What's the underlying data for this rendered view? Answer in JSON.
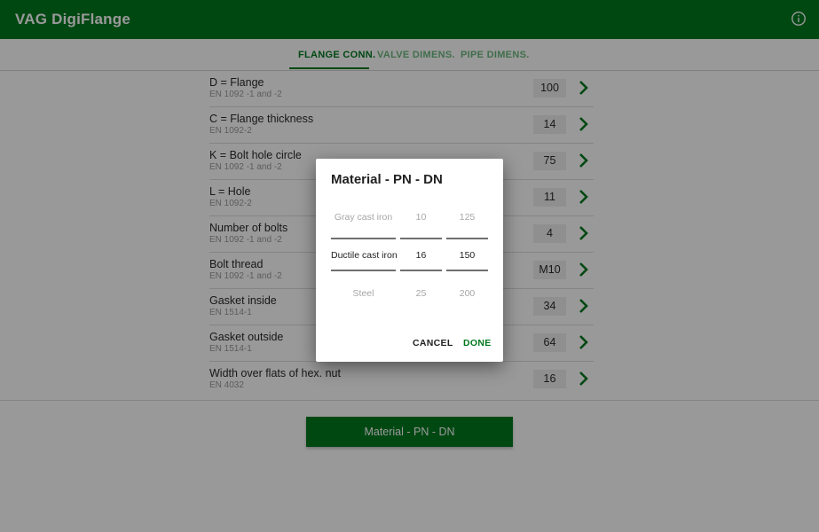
{
  "app": {
    "title": "VAG DigiFlange",
    "info_icon": "info-icon",
    "colors": {
      "brand": "#00781e",
      "tab_inactive": "#6cb77e"
    }
  },
  "tabs": [
    {
      "label": "FLANGE CONN.",
      "active": true
    },
    {
      "label": "VALVE DIMENS.",
      "active": false
    },
    {
      "label": "PIPE DIMENS.",
      "active": false
    }
  ],
  "rows": [
    {
      "title": "D = Flange",
      "sub": "EN 1092 -1 and -2",
      "value": "100"
    },
    {
      "title": "C = Flange thickness",
      "sub": "EN 1092-2",
      "value": "14"
    },
    {
      "title": "K = Bolt hole circle",
      "sub": "EN 1092 -1 and -2",
      "value": "75"
    },
    {
      "title": "L = Hole",
      "sub": "EN 1092-2",
      "value": "11"
    },
    {
      "title": "Number of bolts",
      "sub": "EN 1092 -1 and -2",
      "value": "4"
    },
    {
      "title": "Bolt thread",
      "sub": "EN 1092 -1 and -2",
      "value": "M10"
    },
    {
      "title": "Gasket inside",
      "sub": "EN 1514-1",
      "value": "34"
    },
    {
      "title": "Gasket outside",
      "sub": "EN 1514-1",
      "value": "64"
    },
    {
      "title": "Width over flats of hex. nut",
      "sub": "EN 4032",
      "value": "16"
    }
  ],
  "main_button": {
    "label": "Material - PN - DN"
  },
  "dialog": {
    "title": "Material - PN - DN",
    "material": {
      "prev": "Gray cast iron",
      "selected": "Ductile cast iron",
      "next": "Steel"
    },
    "pn": {
      "prev": "10",
      "selected": "16",
      "next": "25"
    },
    "dn": {
      "prev": "125",
      "selected": "150",
      "next": "200"
    },
    "cancel_label": "CANCEL",
    "done_label": "DONE"
  }
}
